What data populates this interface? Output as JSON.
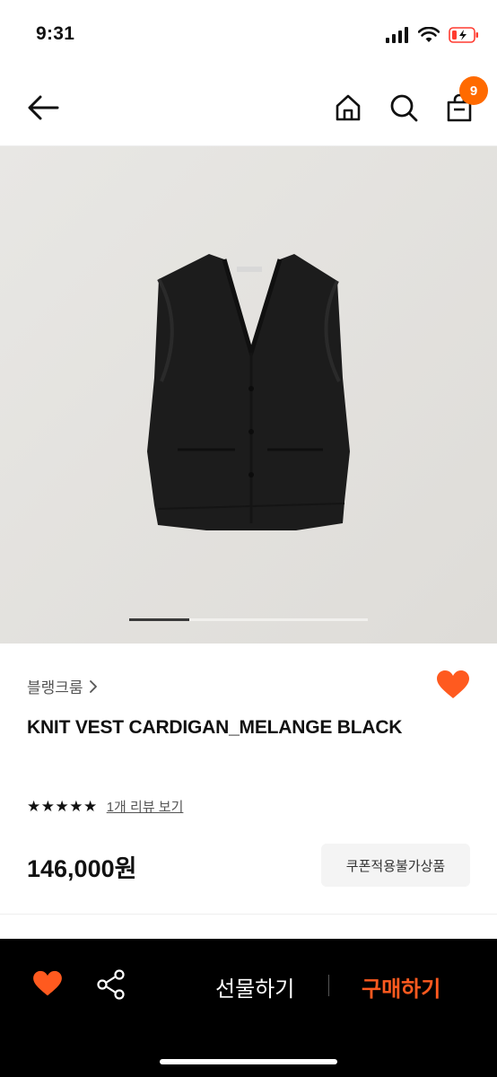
{
  "status_bar": {
    "time": "9:31"
  },
  "nav": {
    "cart_count": "9"
  },
  "product": {
    "brand": "블랭크룸",
    "title": "KNIT VEST CARDIGAN_MELANGE BLACK",
    "rating": 5,
    "review_link": "1개 리뷰 보기",
    "price": "146,000원",
    "coupon_note": "쿠폰적용불가상품",
    "image_index": 1,
    "image_count": 4
  },
  "bottom_bar": {
    "gift_label": "선물하기",
    "buy_label": "구매하기"
  },
  "colors": {
    "accent": "#ff5a1f",
    "badge": "#ff6a00",
    "hero_bg": "#e4e3e0"
  }
}
